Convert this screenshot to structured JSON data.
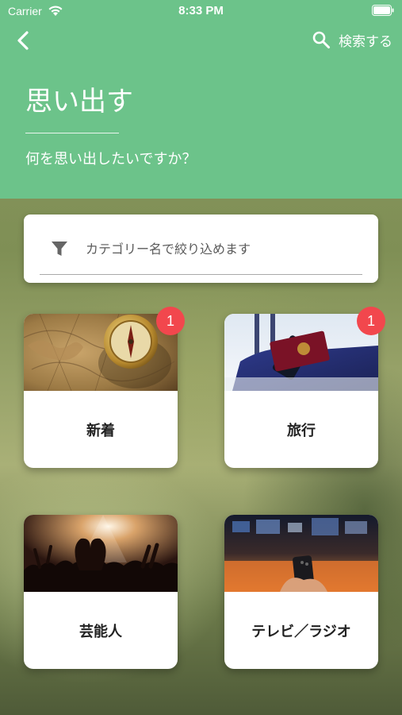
{
  "status_bar": {
    "carrier": "Carrier",
    "time": "8:33 PM"
  },
  "header": {
    "back_icon": "chevron-left-icon",
    "search_label": "検索する",
    "search_icon": "search-icon",
    "title": "思い出す",
    "subtitle": "何を思い出したいですか？",
    "background_color": "#6cc38a"
  },
  "filter": {
    "icon": "filter-icon",
    "placeholder": "カテゴリー名で絞り込めます"
  },
  "categories": [
    {
      "label": "新着",
      "badge": "1",
      "image": "map-and-compass-photo"
    },
    {
      "label": "旅行",
      "badge": "1",
      "image": "suitcase-and-passport-photo"
    },
    {
      "label": "芸能人",
      "image": "concert-crowd-photo"
    },
    {
      "label": "テレビ／ラジオ",
      "image": "tv-remote-photo"
    }
  ],
  "colors": {
    "badge": "#f2474d",
    "accent": "#6cc38a"
  }
}
